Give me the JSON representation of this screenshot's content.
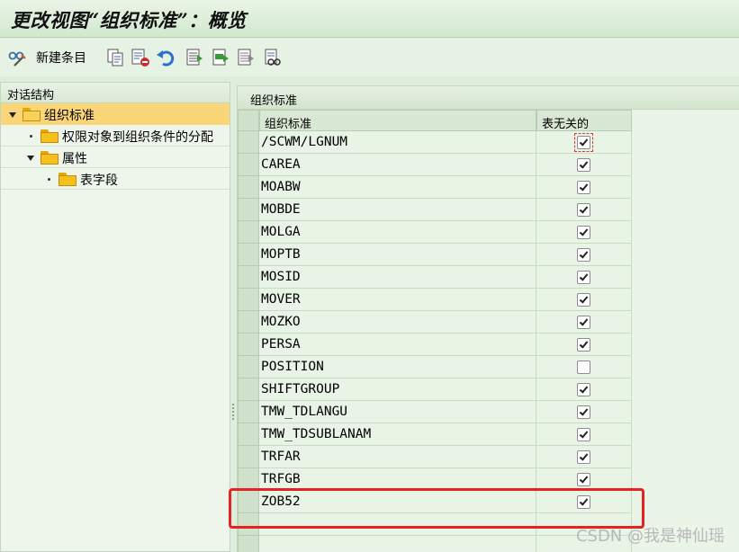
{
  "window": {
    "title": "更改视图“组织标准”：概览"
  },
  "toolbar": {
    "new_entries_label": "新建条目",
    "icons": [
      "glasses-edit-icon",
      "copy-icon",
      "delete-icon",
      "undo-icon",
      "select-all-icon",
      "select-block-icon",
      "deselect-all-icon",
      "detail-icon"
    ]
  },
  "dialog_structure": {
    "title": "对话结构",
    "items": [
      {
        "label": "组织标准",
        "level": 0,
        "expanded": true,
        "selected": true
      },
      {
        "label": "权限对象到组织条件的分配",
        "level": 1
      },
      {
        "label": "属性",
        "level": 1,
        "expanded": true
      },
      {
        "label": "表字段",
        "level": 2
      }
    ]
  },
  "main": {
    "title": "组织标准",
    "columns": [
      "组织标准",
      "表无关的"
    ],
    "rows": [
      {
        "name": "/SCWM/LGNUM",
        "table_independent": true
      },
      {
        "name": "CAREA",
        "table_independent": true
      },
      {
        "name": "MOABW",
        "table_independent": true
      },
      {
        "name": "MOBDE",
        "table_independent": true
      },
      {
        "name": "MOLGA",
        "table_independent": true
      },
      {
        "name": "MOPTB",
        "table_independent": true
      },
      {
        "name": "MOSID",
        "table_independent": true
      },
      {
        "name": "MOVER",
        "table_independent": true
      },
      {
        "name": "MOZKO",
        "table_independent": true
      },
      {
        "name": "PERSA",
        "table_independent": true
      },
      {
        "name": "POSITION",
        "table_independent": false
      },
      {
        "name": "SHIFTGROUP",
        "table_independent": true
      },
      {
        "name": "TMW_TDLANGU",
        "table_independent": true
      },
      {
        "name": "TMW_TDSUBLANAM",
        "table_independent": true
      },
      {
        "name": "TRFAR",
        "table_independent": true
      },
      {
        "name": "TRFGB",
        "table_independent": true
      },
      {
        "name": "ZOB52",
        "table_independent": true
      }
    ]
  },
  "watermark": "CSDN @我是神仙瑶",
  "colors": {
    "background": "#dfeedc",
    "selection": "#fbd679",
    "highlight_box": "#e42323"
  }
}
